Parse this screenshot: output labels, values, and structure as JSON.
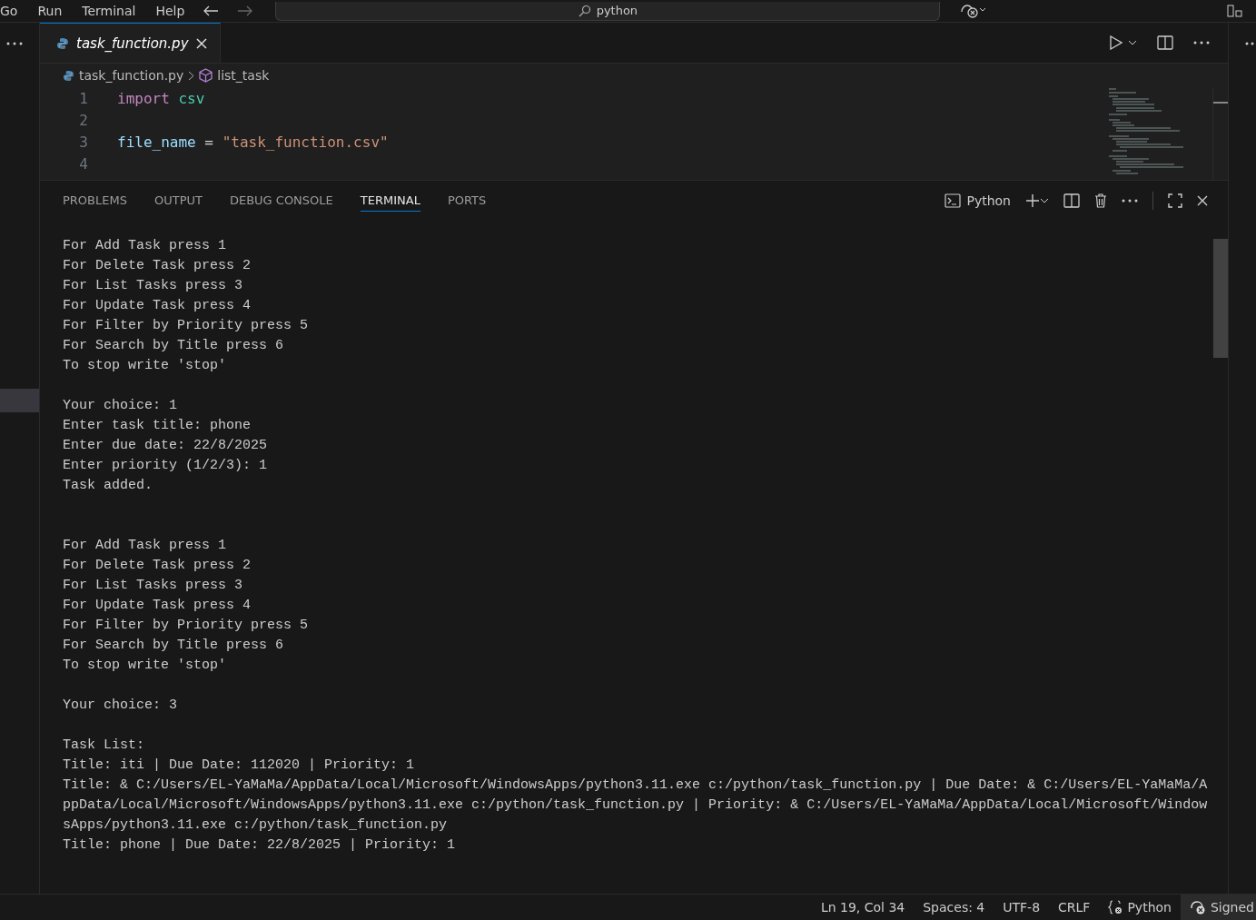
{
  "menu": [
    "Go",
    "Run",
    "Terminal",
    "Help"
  ],
  "search": {
    "value": "python"
  },
  "tabs": [
    {
      "label": "task_function.py",
      "selected": true,
      "preview": true
    }
  ],
  "breadcrumb": [
    {
      "kind": "file",
      "label": "task_function.py"
    },
    {
      "kind": "symbol",
      "label": "list_task"
    }
  ],
  "code": [
    {
      "number": "1",
      "tokens": [
        {
          "kind": "keyword",
          "text": "import"
        },
        {
          "kind": "module",
          "text": "csv"
        }
      ]
    },
    {
      "number": "2"
    },
    {
      "number": "3",
      "tokens": [
        {
          "kind": "variable",
          "text": "file_name"
        },
        {
          "kind": "plain",
          "text": "="
        },
        {
          "kind": "string",
          "text": "\"task_function.csv\""
        }
      ]
    },
    {
      "number": "4"
    }
  ],
  "panel": {
    "tabs": [
      {
        "label": "PROBLEMS",
        "selected": false
      },
      {
        "label": "OUTPUT",
        "selected": false
      },
      {
        "label": "DEBUG CONSOLE",
        "selected": false
      },
      {
        "label": "TERMINAL",
        "selected": true
      },
      {
        "label": "PORTS",
        "selected": false
      }
    ],
    "profile": "Python"
  },
  "terminal": {
    "blocks": [
      {
        "lines": [
          "For Add Task press 1",
          "For Delete Task press 2",
          "For List Tasks press 3",
          "For Update Task press 4",
          "For Filter by Priority press 5",
          "For Search by Title press 6",
          "To stop write 'stop'"
        ]
      },
      {
        "lines": [
          "Your choice: 1",
          "Enter task title: phone",
          "Enter due date: 22/8/2025",
          "Enter priority (1/2/3): 1",
          "Task added."
        ]
      },
      {
        "lines": [
          "For Add Task press 1",
          "For Delete Task press 2",
          "For List Tasks press 3",
          "For Update Task press 4",
          "For Filter by Priority press 5",
          "For Search by Title press 6",
          "To stop write 'stop'"
        ]
      },
      {
        "lines": [
          "Your choice: 3"
        ]
      },
      {
        "lines": [
          "Task List:",
          "Title: iti | Due Date: 112020 | Priority: 1",
          "Title: & C:/Users/EL-YaMaMa/AppData/Local/Microsoft/WindowsApps/python3.11.exe c:/python/task_function.py | Due Date: & C:/Users/EL-YaMaMa/A",
          "ppData/Local/Microsoft/WindowsApps/python3.11.exe c:/python/task_function.py | Priority: & C:/Users/EL-YaMaMa/AppData/Local/Microsoft/Window",
          "sApps/python3.11.exe c:/python/task_function.py",
          "Title: phone | Due Date: 22/8/2025 | Priority: 1"
        ]
      }
    ]
  },
  "status_bar": {
    "items": [
      {
        "kind": "text",
        "label": "Ln 19, Col 34"
      },
      {
        "kind": "text",
        "label": "Spaces: 4"
      },
      {
        "kind": "text",
        "label": "UTF-8"
      },
      {
        "kind": "text",
        "label": "CRLF"
      },
      {
        "kind": "language",
        "label": "Python"
      },
      {
        "kind": "account",
        "label": "Signed"
      }
    ]
  }
}
